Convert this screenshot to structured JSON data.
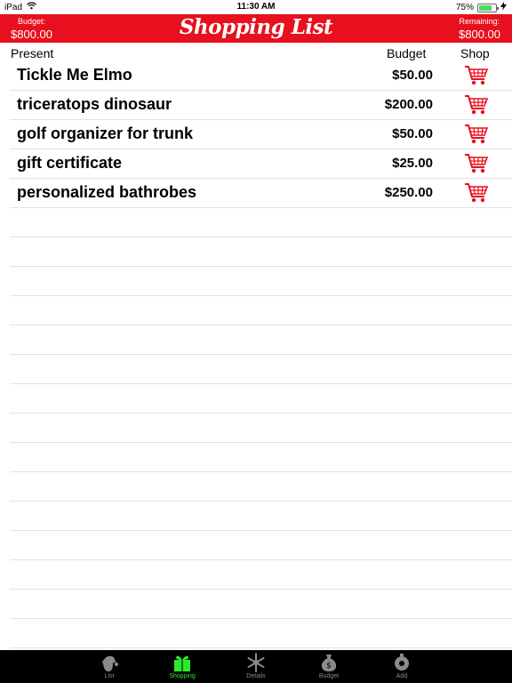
{
  "status": {
    "device": "iPad",
    "time": "11:30 AM",
    "battery_text": "75%",
    "battery_level": 0.75
  },
  "header": {
    "budget_label": "Budget:",
    "budget_value": "$800.00",
    "title": "Shopping List",
    "remaining_label": "Remaining:",
    "remaining_value": "$800.00"
  },
  "columns": {
    "present": "Present",
    "budget": "Budget",
    "shop": "Shop"
  },
  "items": [
    {
      "name": "Tickle Me Elmo",
      "price": "$50.00"
    },
    {
      "name": "triceratops dinosaur",
      "price": "$200.00"
    },
    {
      "name": "golf organizer for trunk",
      "price": "$50.00"
    },
    {
      "name": "gift certificate",
      "price": "$25.00"
    },
    {
      "name": "personalized bathrobes",
      "price": "$250.00"
    }
  ],
  "tabs": [
    {
      "label": "List",
      "icon": "santa-icon"
    },
    {
      "label": "Shopping",
      "icon": "gift-icon",
      "active": true
    },
    {
      "label": "Details",
      "icon": "snowflake-icon"
    },
    {
      "label": "Budget",
      "icon": "money-bag-icon"
    },
    {
      "label": "Add",
      "icon": "ornament-icon"
    }
  ],
  "colors": {
    "header_bg": "#e8101e",
    "cart": "#e8101e",
    "tab_active": "#2ee82e",
    "tab_inactive": "#8a8a8a"
  }
}
